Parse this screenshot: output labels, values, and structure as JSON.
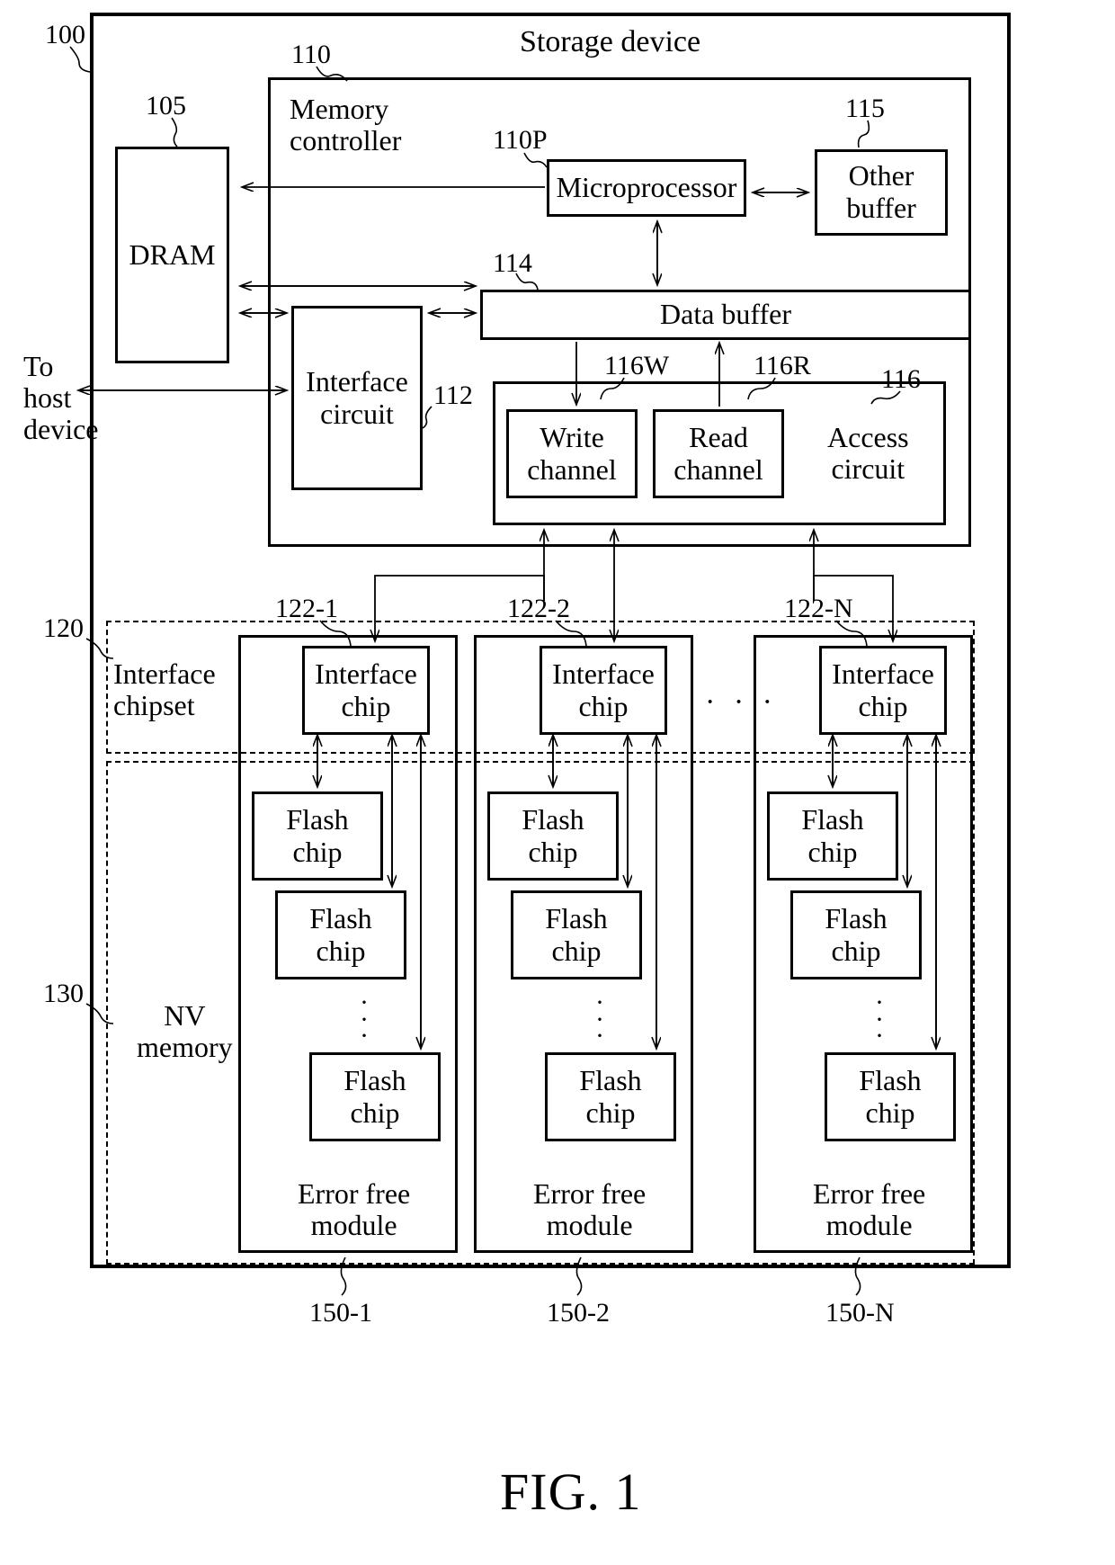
{
  "figure": {
    "caption": "FIG. 1"
  },
  "outer": {
    "title": "Storage device",
    "ref": "100"
  },
  "host": {
    "label": "To\nhost\ndevice"
  },
  "dram": {
    "label": "DRAM",
    "ref": "105"
  },
  "memory_controller": {
    "label": "Memory\ncontroller",
    "ref": "110"
  },
  "microprocessor": {
    "label": "Microprocessor",
    "ref": "110P"
  },
  "other_buffer": {
    "label": "Other\nbuffer",
    "ref": "115"
  },
  "data_buffer": {
    "label": "Data buffer",
    "ref": "114"
  },
  "interface_circuit": {
    "label": "Interface\ncircuit",
    "ref": "112"
  },
  "access_circuit": {
    "label": "Access\ncircuit",
    "ref": "116",
    "write_channel": {
      "label": "Write\nchannel",
      "ref": "116W"
    },
    "read_channel": {
      "label": "Read\nchannel",
      "ref": "116R"
    }
  },
  "interface_chipset": {
    "label": "Interface\nchipset",
    "ref": "120"
  },
  "nv_memory": {
    "label": "NV\nmemory",
    "ref": "130"
  },
  "ellipsis_horizontal": "· · ·",
  "ellipsis_vertical": "·\n·\n·",
  "modules": [
    {
      "module_ref": "150-1",
      "module_label": "Error free\nmodule",
      "interface_chip": {
        "label": "Interface\nchip",
        "ref": "122-1"
      },
      "flash_chips": [
        {
          "label": "Flash\nchip"
        },
        {
          "label": "Flash\nchip"
        },
        {
          "label": "Flash\nchip"
        }
      ]
    },
    {
      "module_ref": "150-2",
      "module_label": "Error free\nmodule",
      "interface_chip": {
        "label": "Interface\nchip",
        "ref": "122-2"
      },
      "flash_chips": [
        {
          "label": "Flash\nchip"
        },
        {
          "label": "Flash\nchip"
        },
        {
          "label": "Flash\nchip"
        }
      ]
    },
    {
      "module_ref": "150-N",
      "module_label": "Error free\nmodule",
      "interface_chip": {
        "label": "Interface\nchip",
        "ref": "122-N"
      },
      "flash_chips": [
        {
          "label": "Flash\nchip"
        },
        {
          "label": "Flash\nchip"
        },
        {
          "label": "Flash\nchip"
        }
      ]
    }
  ]
}
